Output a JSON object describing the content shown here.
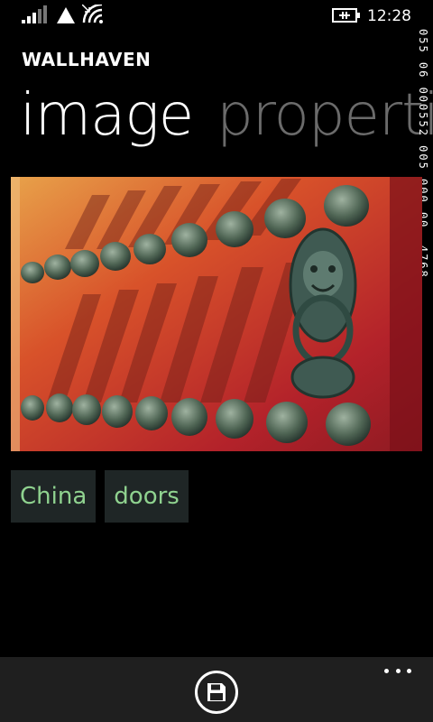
{
  "status_bar": {
    "time": "12:28",
    "icons": [
      "signal-icon",
      "roaming-icon",
      "wifi-icon",
      "battery-charging-icon"
    ]
  },
  "app": {
    "title": "WALLHAVEN"
  },
  "pivot": {
    "items": [
      {
        "label": "image",
        "active": true
      },
      {
        "label": "properties",
        "active": false
      }
    ]
  },
  "image_meta": {
    "vertical_text": "055 06 000552 005 000 00 .4768"
  },
  "wallpaper": {
    "alt": "red door with brass studs and lion head knocker"
  },
  "tags": [
    {
      "label": "China"
    },
    {
      "label": "doors"
    }
  ],
  "app_bar": {
    "buttons": [
      {
        "icon": "save-icon"
      }
    ],
    "more_icon": "ellipsis-icon"
  },
  "colors": {
    "background": "#000000",
    "tag_background": "#1f2626",
    "tag_text": "#8fd28f",
    "app_bar_background": "#1f1f1f",
    "inactive_header": "#6b6b6b"
  }
}
